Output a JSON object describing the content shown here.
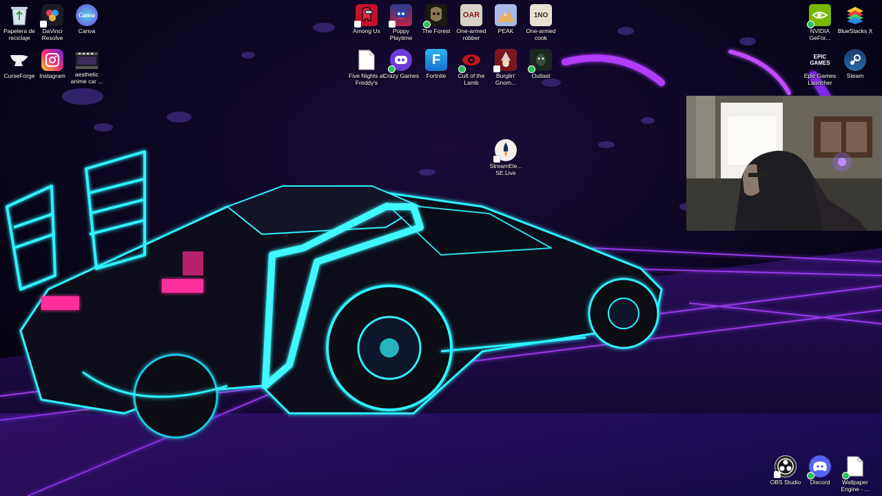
{
  "desktop": {
    "icons": [
      {
        "label": "Papelera de reciclaje",
        "icon": "recycle-bin-icon"
      },
      {
        "label": "DaVinci Resolve",
        "icon": "davinci-resolve-icon"
      },
      {
        "label": "Canva",
        "icon": "canva-icon",
        "glyph": "Canva"
      },
      {
        "label": "CurseForge",
        "icon": "curseforge-icon"
      },
      {
        "label": "Instagram",
        "icon": "instagram-icon"
      },
      {
        "label": "aesthetic anime car ...",
        "icon": "video-file-icon"
      },
      {
        "label": "Among Us",
        "icon": "among-us-icon"
      },
      {
        "label": "Poppy Playtime",
        "icon": "poppy-playtime-icon"
      },
      {
        "label": "The Forest",
        "icon": "the-forest-icon"
      },
      {
        "label": "One-armed robber",
        "icon": "one-armed-robber-icon",
        "glyph": "OAR"
      },
      {
        "label": "PEAK",
        "icon": "peak-icon"
      },
      {
        "label": "One-armed cook",
        "icon": "one-armed-cook-icon",
        "glyph": "1NO"
      },
      {
        "label": "Five Nights at Freddy's",
        "icon": "blank-file-icon"
      },
      {
        "label": "Crazy Games",
        "icon": "crazy-games-icon"
      },
      {
        "label": "Fortnite",
        "icon": "fortnite-icon",
        "glyph": "F"
      },
      {
        "label": "Cult of the Lamb",
        "icon": "cult-of-the-lamb-icon"
      },
      {
        "label": "Burglin' Gnom...",
        "icon": "burglin-gnomes-icon"
      },
      {
        "label": "Outlast",
        "icon": "outlast-icon"
      },
      {
        "label": "StreamEle... SE.Live",
        "icon": "streamelements-icon"
      },
      {
        "label": "NVIDIA GeFor...",
        "icon": "nvidia-icon"
      },
      {
        "label": "BlueStacks X",
        "icon": "bluestacks-icon"
      },
      {
        "label": "Epic Games Launcher",
        "icon": "epic-games-icon",
        "glyph": "EPIC GAMES"
      },
      {
        "label": "Steam",
        "icon": "steam-icon"
      },
      {
        "label": "OBS Studio",
        "icon": "obs-icon"
      },
      {
        "label": "Discord",
        "icon": "discord-icon"
      },
      {
        "label": "Wallpaper Engine - ...",
        "icon": "blank-file-icon"
      }
    ]
  },
  "colors": {
    "neon_cyan": "#30f2ff",
    "neon_purple": "#9b3cff",
    "neon_pink": "#ff2f9e",
    "night_sky": "#05030c"
  }
}
